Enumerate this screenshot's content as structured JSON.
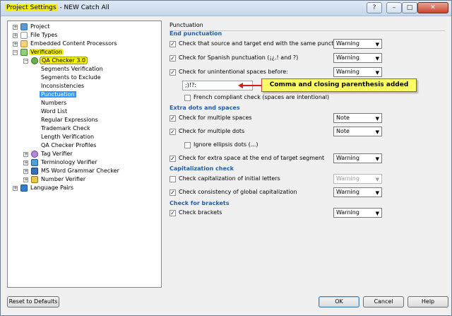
{
  "window": {
    "title": "Project Settings",
    "subtitle": " - NEW Catch All"
  },
  "titlebar_buttons": {
    "help": "?",
    "minimize": "–",
    "maximize": "□",
    "close": "✕"
  },
  "tree": {
    "project": "Project",
    "file_types": "File Types",
    "embedded": "Embedded Content Processors",
    "verification": "Verification",
    "qa_checker": "QA Checker 3.0",
    "qa_children": [
      "Segments Verification",
      "Segments to Exclude",
      "Inconsistencies",
      "Punctuation",
      "Numbers",
      "Word List",
      "Regular Expressions",
      "Trademark Check",
      "Length Verification",
      "QA Checker Profiles"
    ],
    "tag_verifier": "Tag Verifier",
    "terminology": "Terminology Verifier",
    "msword": "MS Word Grammar Checker",
    "number_verifier": "Number Verifier",
    "language_pairs": "Language Pairs"
  },
  "panel": {
    "title": "Punctuation",
    "sections": {
      "end": "End punctuation",
      "extra": "Extra dots and spaces",
      "cap": "Capitalization check",
      "brackets": "Check for brackets"
    },
    "checks": {
      "source_target_end": {
        "label": "Check that source and target end with the same punctuation",
        "checked": true,
        "value": "Warning"
      },
      "spanish": {
        "label": "Check for Spanish punctuation (¡¿.! and ?)",
        "checked": true,
        "value": "Warning"
      },
      "unintentional": {
        "label": "Check for unintentional spaces before:",
        "checked": true,
        "value": "Warning"
      },
      "unintentional_chars": ";)!?:",
      "french": {
        "label": "French compliant check (spaces are intentional)",
        "checked": false
      },
      "multi_spaces": {
        "label": "Check for multiple spaces",
        "checked": true,
        "value": "Note"
      },
      "multi_dots": {
        "label": "Check for multiple dots",
        "checked": true,
        "value": "Note"
      },
      "ellipsis": {
        "label": "Ignore ellipsis dots (...)",
        "checked": false
      },
      "extra_space_end": {
        "label": "Check for extra space at the end of target segment",
        "checked": true,
        "value": "Warning"
      },
      "cap_initial": {
        "label": "Check capitalization of initial letters",
        "checked": false,
        "value": "Warning"
      },
      "cap_global": {
        "label": "Check consistency of global capitalization",
        "checked": true,
        "value": "Warning"
      },
      "brackets": {
        "label": "Check brackets",
        "checked": true,
        "value": "Warning"
      }
    },
    "callout": "Comma and closing parenthesis added"
  },
  "check_mark": "✓",
  "dropdown_arrow": "▼",
  "buttons": {
    "reset": "Reset to Defaults",
    "ok": "OK",
    "cancel": "Cancel",
    "help": "Help"
  }
}
